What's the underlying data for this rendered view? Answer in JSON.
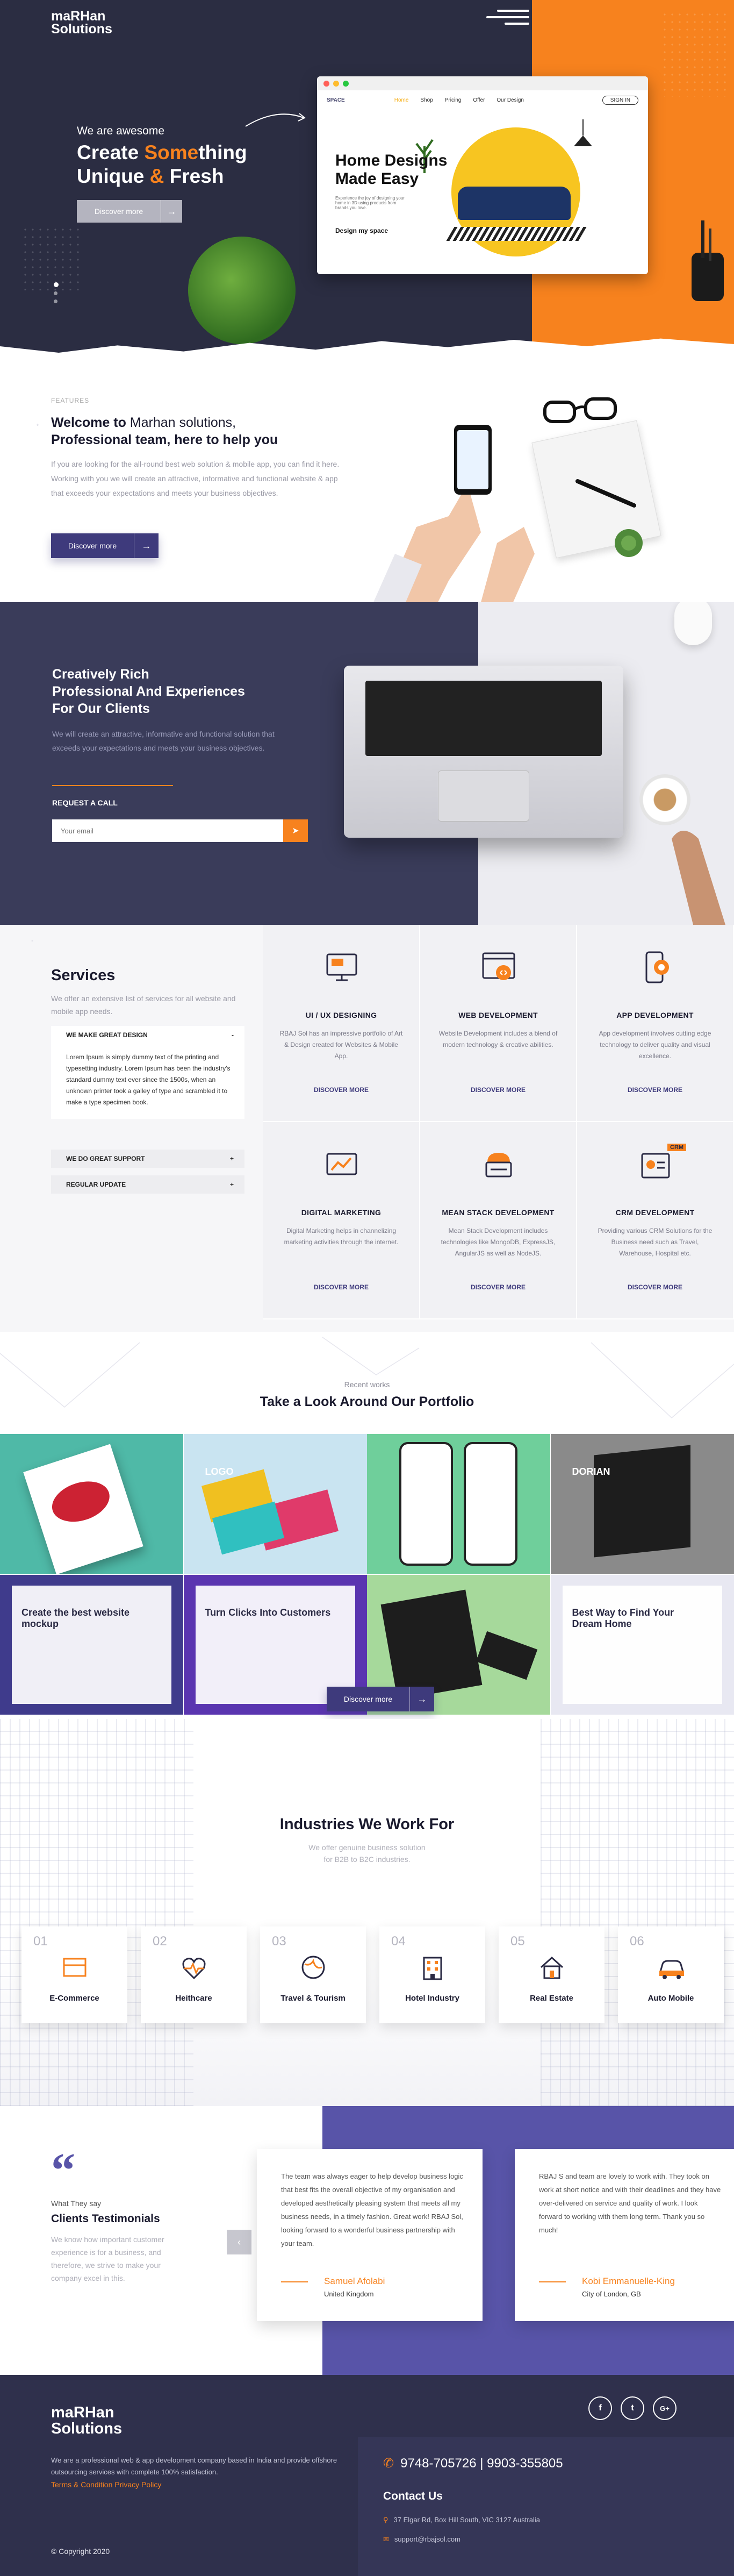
{
  "header": {
    "logo_line1": "maRHan",
    "logo_line2": "Solutions"
  },
  "hero": {
    "pretitle": "We are awesome",
    "title_a": "Create ",
    "title_b": "Some",
    "title_c": "thing",
    "title_d": "Unique ",
    "title_e": "&",
    "title_f": " Fresh",
    "cta": "Discover more",
    "mock": {
      "brand": "SPACE",
      "nav": [
        "Home",
        "Shop",
        "Pricing",
        "Offer",
        "Our Design"
      ],
      "btn": "SIGN IN",
      "headline_1": "Home Designs",
      "headline_2": "Made Easy",
      "blurb": "Experience the joy of designing your home in 3D using products from brands you love.",
      "card": "Design my space"
    }
  },
  "features": {
    "label": "FEATURES",
    "title_a": "Welcome to ",
    "title_b": "Marhan solutions,",
    "title_c": "Professional team, here to help you",
    "text": "If you are looking for the all-round best web solution & mobile app, you can find it here. Working with you we will create an attractive, informative and functional website & app that exceeds your expectations and meets your business objectives.",
    "cta": "Discover more"
  },
  "call": {
    "title_1": "Creatively Rich",
    "title_2": "Professional And Experiences",
    "title_3": "For Our Clients",
    "text": "We will create an attractive, informative and functional solution that exceeds your expectations and meets your business objectives.",
    "label": "REQUEST A CALL",
    "placeholder": "Your email"
  },
  "services": {
    "title": "Services",
    "subtitle": "We offer an extensive list of services for all website and mobile app needs.",
    "accordion": [
      {
        "title": "WE MAKE GREAT DESIGN",
        "symbol": "-",
        "body": "Lorem Ipsum is simply dummy text of the printing and typesetting industry. Lorem Ipsum has been the industry's standard dummy text ever since the 1500s, when an unknown printer took a galley of type and scrambled it to make a type specimen book."
      },
      {
        "title": "WE DO GREAT SUPPORT",
        "symbol": "+"
      },
      {
        "title": "REGULAR UPDATE",
        "symbol": "+"
      }
    ],
    "items": [
      {
        "title": "UI / UX DESIGNING",
        "text": "RBAJ Sol has an impressive portfolio of Art & Design created for Websites & Mobile App.",
        "link": "DISCOVER MORE",
        "icon": "monitor-icon"
      },
      {
        "title": "WEB DEVELOPMENT",
        "text": "Website Development includes a blend of modern technology & creative abilities.",
        "link": "DISCOVER MORE",
        "icon": "browser-code-icon"
      },
      {
        "title": "APP DEVELOPMENT",
        "text": "App development involves cutting edge technology to deliver quality and visual excellence.",
        "link": "DISCOVER MORE",
        "icon": "mobile-app-icon"
      },
      {
        "title": "DIGITAL MARKETING",
        "text": "Digital Marketing helps in channelizing marketing activities through the internet.",
        "link": "DISCOVER MORE",
        "icon": "marketing-icon"
      },
      {
        "title": "MEAN STACK DEVELOPMENT",
        "text": "Mean Stack Development includes technologies like MongoDB, ExpressJS, AngularJS as well as NodeJS.",
        "link": "DISCOVER MORE",
        "icon": "server-icon"
      },
      {
        "title": "CRM DEVELOPMENT",
        "text": "Providing various CRM Solutions for the Business need such as Travel, Warehouse, Hospital etc.",
        "link": "DISCOVER MORE",
        "icon": "crm-icon",
        "badge": "CRM"
      }
    ]
  },
  "portfolio": {
    "label": "Recent works",
    "title": "Take a Look Around Our Portfolio",
    "tiles": [
      {
        "icon": "book-mockup-icon",
        "bg": "#4fb9a7"
      },
      {
        "icon": "business-cards-icon",
        "bg": "#c9e4f1",
        "text": "LOGO"
      },
      {
        "icon": "finance-app-icon",
        "bg": "#6fcf9b"
      },
      {
        "icon": "signage-icon",
        "bg": "#8a8a8a",
        "text": "DORIAN"
      },
      {
        "icon": "website-mockup-icon",
        "bg": "#3f3b8c",
        "text": "Create the best website mockup"
      },
      {
        "icon": "website-mockup-icon",
        "bg": "#5a35b0",
        "text": "Turn Clicks Into Customers"
      },
      {
        "icon": "stationery-icon",
        "bg": "#a6d99b"
      },
      {
        "icon": "website-mockup-icon",
        "bg": "#e8e8f2",
        "text": "Best Way to Find Your Dream Home"
      }
    ],
    "cta": "Discover more"
  },
  "industries": {
    "title": "Industries We Work For",
    "sub_1": "We offer genuine business solution",
    "sub_2": "for B2B to B2C industries.",
    "items": [
      {
        "no": "01",
        "name": "E-Commerce",
        "icon": "cart-icon"
      },
      {
        "no": "02",
        "name": "Heithcare",
        "icon": "heartbeat-icon"
      },
      {
        "no": "03",
        "name": "Travel & Tourism",
        "icon": "globe-icon"
      },
      {
        "no": "04",
        "name": "Hotel Industry",
        "icon": "hotel-icon"
      },
      {
        "no": "05",
        "name": "Real Estate",
        "icon": "house-icon"
      },
      {
        "no": "06",
        "name": "Auto Mobile",
        "icon": "car-icon"
      }
    ]
  },
  "testimonials": {
    "quote_mark": "“",
    "label": "What They say",
    "title": "Clients Testimonials",
    "subtitle": "We know how important customer experience is for a business, and therefore, we strive to make your company excel in this.",
    "cards": [
      {
        "text": "The team was always eager to help develop business logic that best fits the overall objective of my organisation and developed aesthetically pleasing system that meets all my business needs, in a timely fashion. Great work! RBAJ Sol, looking forward to a wonderful business partnership with your team.",
        "author": "Samuel Afolabi",
        "location": "United Kingdom"
      },
      {
        "text": "RBAJ S and team are lovely to work with. They took on work at short notice and with their deadlines and they have over-delivered on service and quality of work. I look forward to working with them long term. Thank you so much!",
        "author": "Kobi Emmanuelle-King",
        "location": "City of London, GB"
      }
    ]
  },
  "footer": {
    "logo_line1": "maRHan",
    "logo_line2": "Solutions",
    "about": "We are a professional web & app development company based in India and provide offshore outsourcing services with complete 100% satisfaction.",
    "links": "Terms & Condition  Privacy Policy",
    "copyright": "© Copyright 2020",
    "social": [
      "f",
      "t",
      "G+"
    ],
    "phone": "9748-705726 | 9903-355805",
    "contact_title": "Contact Us",
    "address": "37 Elgar Rd, Box Hill South, VIC 3127 Australia",
    "email": "support@rbajsol.com"
  },
  "colors": {
    "accent": "#f7821e",
    "primary": "#3e3a7c",
    "dark": "#2b2d42"
  }
}
